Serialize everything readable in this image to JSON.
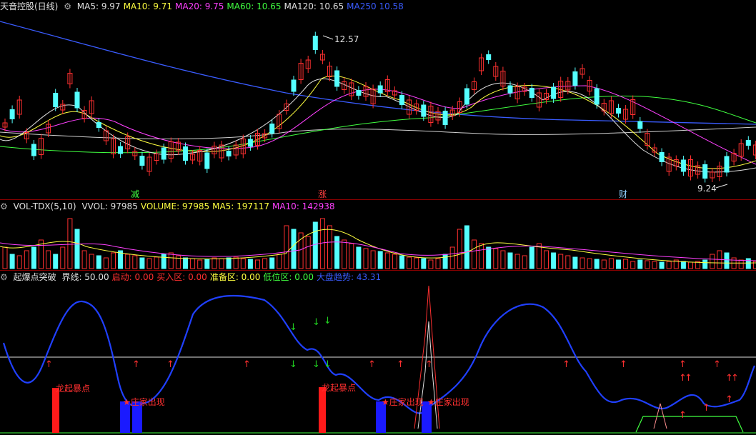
{
  "price_panel": {
    "title": "天音控股(日线)",
    "indicators": [
      {
        "label": "MA5: 9.97",
        "color": "#e0e0e0"
      },
      {
        "label": "MA10: 9.71",
        "color": "#ffff40"
      },
      {
        "label": "MA20: 9.75",
        "color": "#ff40ff"
      },
      {
        "label": "MA60: 10.65",
        "color": "#40ff40"
      },
      {
        "label": "MA120: 10.65",
        "color": "#e0e0e0"
      },
      {
        "label": "MA250  10.58",
        "color": "#3a5cff"
      }
    ],
    "high_label": "12.57",
    "low_label": "9.24",
    "marks": [
      {
        "text": "减",
        "color": "#40ff40"
      },
      {
        "text": "涨",
        "color": "#ff4040"
      },
      {
        "text": "财",
        "color": "#8fd0ff"
      }
    ]
  },
  "vol_panel": {
    "title": "VOL-TDX(5,10)",
    "items": [
      {
        "label": "VVOL: 97985",
        "color": "#e0e0e0"
      },
      {
        "label": "VOLUME: 97985",
        "color": "#ffff40"
      },
      {
        "label": "MA5: 197117",
        "color": "#ffff40"
      },
      {
        "label": "MA10: 142938",
        "color": "#ff40ff"
      }
    ]
  },
  "ind_panel": {
    "title": "起爆点突破",
    "items": [
      {
        "label": "界线: 50.00",
        "color": "#e0e0e0"
      },
      {
        "label": "启动: 0.00",
        "color": "#ff3030"
      },
      {
        "label": "买入区: 0.00",
        "color": "#ff3030"
      },
      {
        "label": "准备区: 0.00",
        "color": "#ffff40"
      },
      {
        "label": "低位区: 0.00",
        "color": "#40ff40"
      },
      {
        "label": "大盘趋势: 43.31",
        "color": "#3a5cff"
      }
    ],
    "signal_labels": [
      "龙起暴点",
      "★庄家出现",
      "龙起暴点",
      "★庄家出现",
      "★庄家出现"
    ]
  },
  "colors": {
    "up": "#ff3030",
    "down": "#54ffff",
    "ma5": "#e0e0e0",
    "ma10": "#ffff40",
    "ma20": "#ff40ff",
    "ma60": "#40ff40",
    "ma250": "#3a5cff",
    "border": "#8b0000"
  }
}
